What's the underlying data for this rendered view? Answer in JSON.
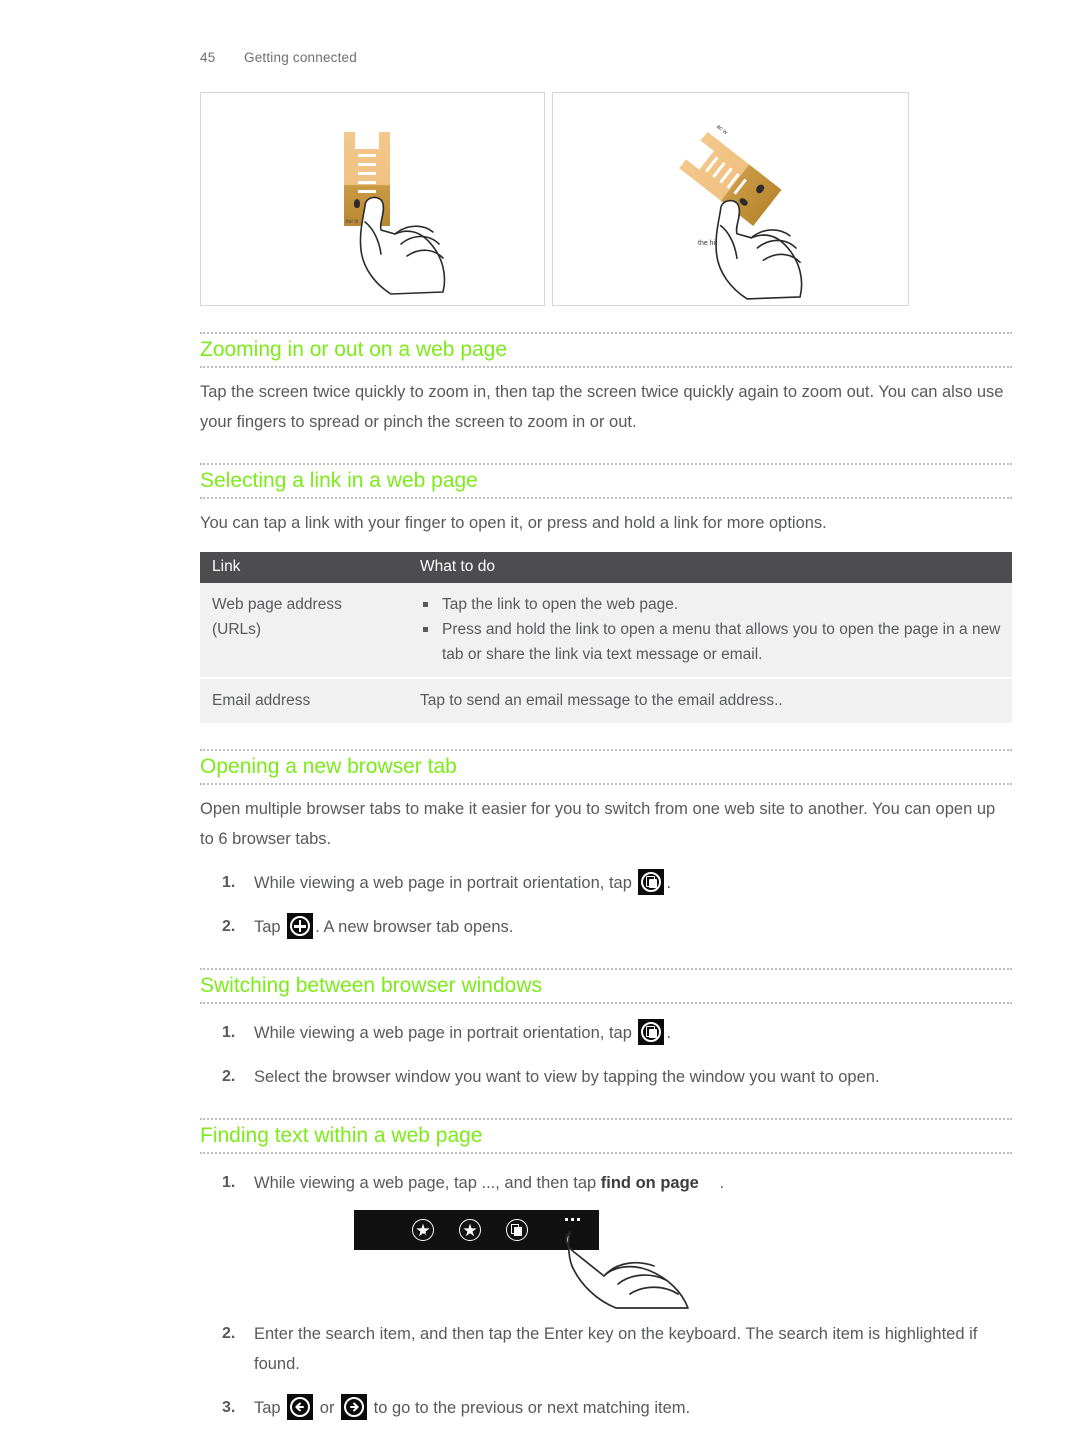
{
  "header": {
    "page_number": "45",
    "chapter": "Getting connected"
  },
  "figures": {
    "portrait": {
      "caption_text": "the fir",
      "label": "phone-portrait-tap-illustration"
    },
    "landscape": {
      "caption_text": "the hi",
      "side_label": "ac w",
      "label": "phone-landscape-tap-illustration"
    }
  },
  "sections": [
    {
      "id": "zooming",
      "heading": "Zooming in or out on a web page",
      "paragraphs": [
        "Tap the screen twice quickly to zoom in, then tap the screen twice quickly again to zoom out. You can also use your fingers to spread or pinch the screen to zoom in or out."
      ]
    },
    {
      "id": "selecting-link",
      "heading": "Selecting a link in a web page",
      "paragraphs": [
        "You can tap a link with your finger to open it, or press and hold a link for more options."
      ]
    },
    {
      "id": "opening-tab",
      "heading": "Opening a new browser tab",
      "paragraphs": [
        "Open multiple browser tabs to make it easier for you to switch from one web site to another. You can open up to 6 browser tabs."
      ]
    },
    {
      "id": "switching-windows",
      "heading": "Switching between browser windows"
    },
    {
      "id": "finding-text",
      "heading": "Finding text within a web page"
    }
  ],
  "table": {
    "columns": [
      "Link",
      "What to do"
    ],
    "rows": [
      {
        "link": "Web page address\n(URLs)",
        "link_line1": "Web page address",
        "link_line2": "(URLs)",
        "bullets": [
          "Tap the link to open the web page.",
          "Press and hold the link to open a menu that allows you to open the page in a new tab or share the link via text message or email."
        ]
      },
      {
        "link": "Email address",
        "link_line1": "Email address",
        "link_line2": "",
        "plain": "Tap to send an email message to the email address.."
      }
    ]
  },
  "steps": {
    "opening_tab": [
      {
        "before": "While viewing a web page in portrait orientation, tap",
        "icon": "browser-tabs-icon",
        "after": "."
      },
      {
        "before": "Tap",
        "icon": "plus-icon",
        "after": ". A new browser tab opens."
      }
    ],
    "switching_windows": [
      {
        "before": "While viewing a web page in portrait orientation, tap",
        "icon": "browser-tabs-icon",
        "after": "."
      },
      {
        "before": "Select the browser window you want to view by tapping the window you want to open.",
        "icon": "",
        "after": ""
      }
    ],
    "finding_text": [
      {
        "before": "While viewing a web page, tap",
        "ellipsis": "...",
        "middle": ", and then tap",
        "bold": "find on page",
        "after": "."
      },
      {
        "before": "Enter the search item, and then tap the Enter key on the keyboard. The search item is highlighted if found.",
        "after": ""
      },
      {
        "before": "Tap",
        "icon_prev": "arrow-left-icon",
        "middle": "or",
        "icon_next": "arrow-right-icon",
        "after": "to go to the previous or next matching item."
      }
    ]
  },
  "toolbar_figure": {
    "icons": [
      "add-bookmark-star-icon",
      "bookmarks-star-icon",
      "browser-tabs-icon",
      "more-options-ellipsis-icon"
    ]
  },
  "colors": {
    "heading_green": "#7ceb19",
    "body_gray": "#58595b",
    "table_header_bg": "#4d4d4f",
    "table_row_bg": "#f1f1f1",
    "toolbar_bg": "#111111"
  }
}
